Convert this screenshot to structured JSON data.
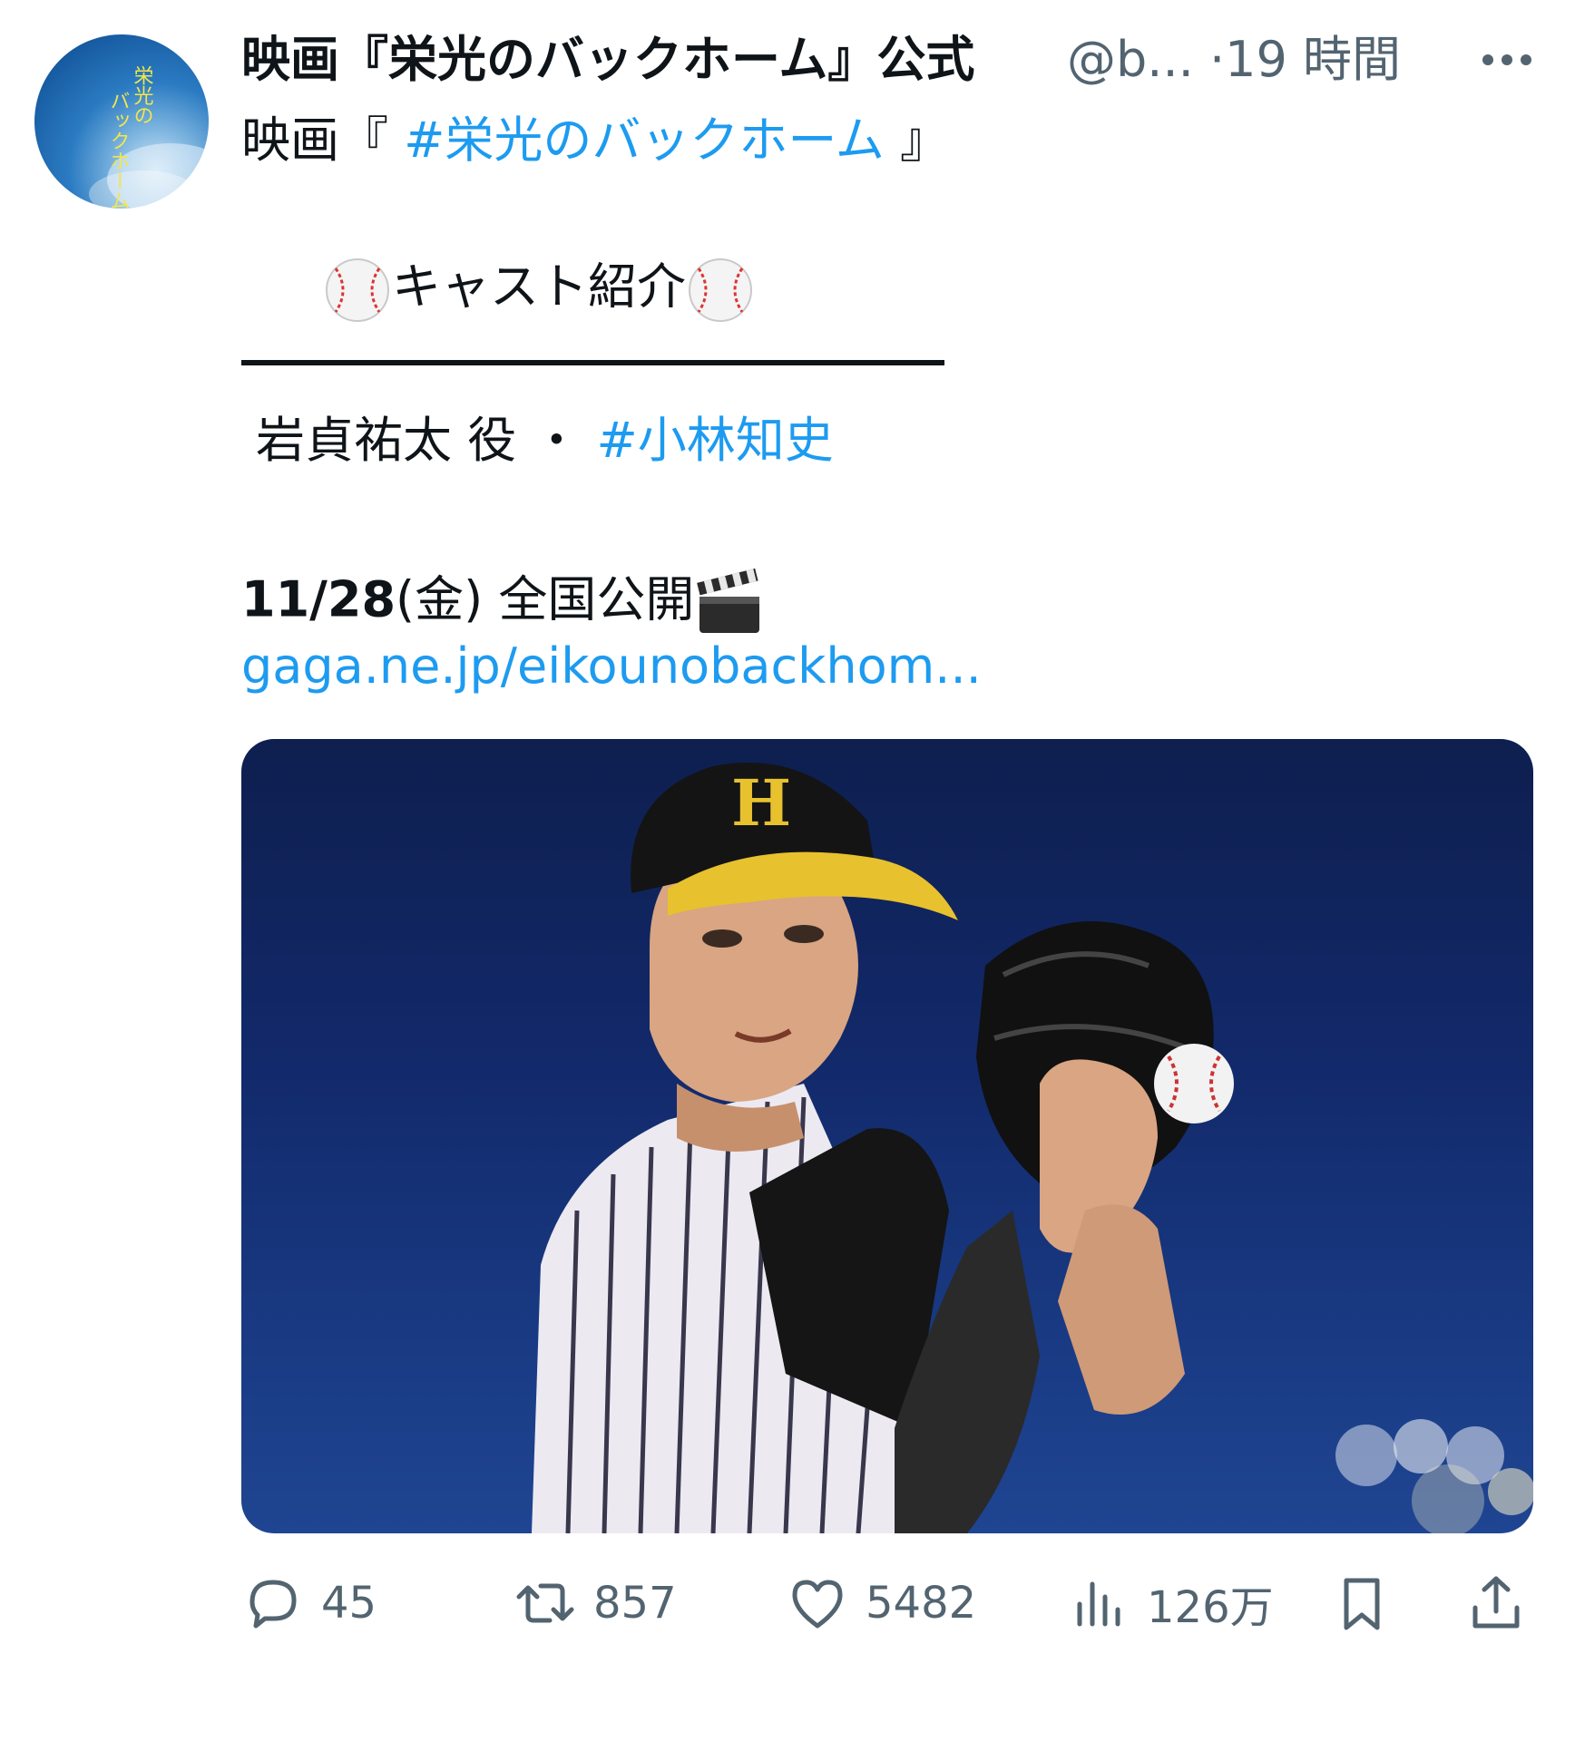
{
  "author": {
    "display_name": "映画『栄光のバックホーム』公式",
    "handle": "@b...",
    "time_separator": "·",
    "time": "19 時間",
    "avatar_text": "栄光の\nバックホーム"
  },
  "tweet": {
    "line1_prefix": "映画『 ",
    "line1_hashtag": "#栄光のバックホーム",
    "line1_suffix": " 』",
    "cast_heading": "キャスト紹介",
    "role_text": "岩貞祐太 役 ・ ",
    "role_hashtag": "#小林知史",
    "release_date": "11/28",
    "release_rest": "(金) 全国公開",
    "url": "gaga.ne.jp/eikounobackhom..."
  },
  "media": {
    "cap_logo_letter": "H"
  },
  "actions": {
    "reply_count": "45",
    "retweet_count": "857",
    "like_count": "5482",
    "views_count": "126万"
  },
  "colors": {
    "link": "#1d9bf0",
    "text": "#0f1419",
    "muted": "#536471",
    "media_sky": "#12296a"
  }
}
